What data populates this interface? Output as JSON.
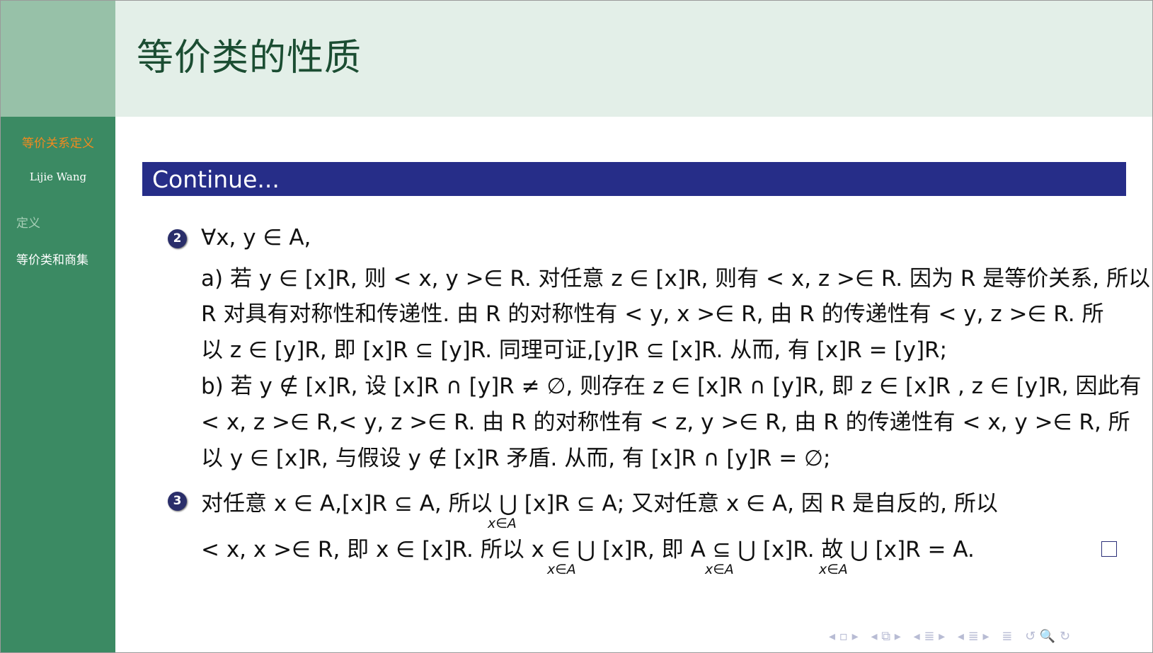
{
  "sidebar": {
    "section": "等价关系定义",
    "author": "Lijie Wang",
    "items": [
      {
        "label": "定义"
      },
      {
        "label": "等价类和商集"
      }
    ]
  },
  "header": {
    "title": "等价类的性质"
  },
  "block": {
    "title": "Continue..."
  },
  "items": [
    {
      "number": "2",
      "lines": [
        "∀x, y ∈ A,",
        "a) 若 y ∈ [x]R, 则 < x, y >∈ R. 对任意 z ∈ [x]R, 则有 < x, z >∈ R. 因为 R 是等价关系, 所以",
        "R 对具有对称性和传递性. 由 R 的对称性有 < y, x >∈ R, 由 R 的传递性有 < y, z >∈ R. 所",
        "以 z ∈ [y]R, 即 [x]R ⊆ [y]R. 同理可证,[y]R ⊆ [x]R. 从而, 有 [x]R = [y]R;",
        "b) 若 y ∉ [x]R, 设 [x]R ∩ [y]R ≠ ∅, 则存在 z ∈ [x]R ∩ [y]R, 即 z ∈ [x]R , z ∈ [y]R, 因此有",
        "< x, z >∈ R,< y, z >∈ R. 由 R 的对称性有 < z, y >∈ R, 由 R 的传递性有 < x, y >∈ R, 所",
        "以 y ∈ [x]R, 与假设 y ∉ [x]R 矛盾. 从而, 有 [x]R ∩ [y]R = ∅;"
      ]
    },
    {
      "number": "3",
      "lines": [
        "对任意 x ∈ A,[x]R ⊆ A, 所以 ⋃ [x]R ⊆ A; 又对任意 x ∈ A, 因 R 是自反的, 所以",
        "< x, x >∈ R, 即 x ∈ [x]R. 所以 x ∈ ⋃ [x]R, 即 A ⊆ ⋃ [x]R. 故 ⋃ [x]R = A."
      ],
      "subscripts": [
        "x∈A",
        "x∈A",
        "x∈A",
        "x∈A"
      ]
    }
  ],
  "nav": {
    "symbols": [
      "◂ ▫ ▸",
      "◂ ⧉ ▸",
      "◂ ≣ ▸",
      "◂ ≣ ▸",
      "≣",
      "↺ 🔍 ↻"
    ]
  }
}
